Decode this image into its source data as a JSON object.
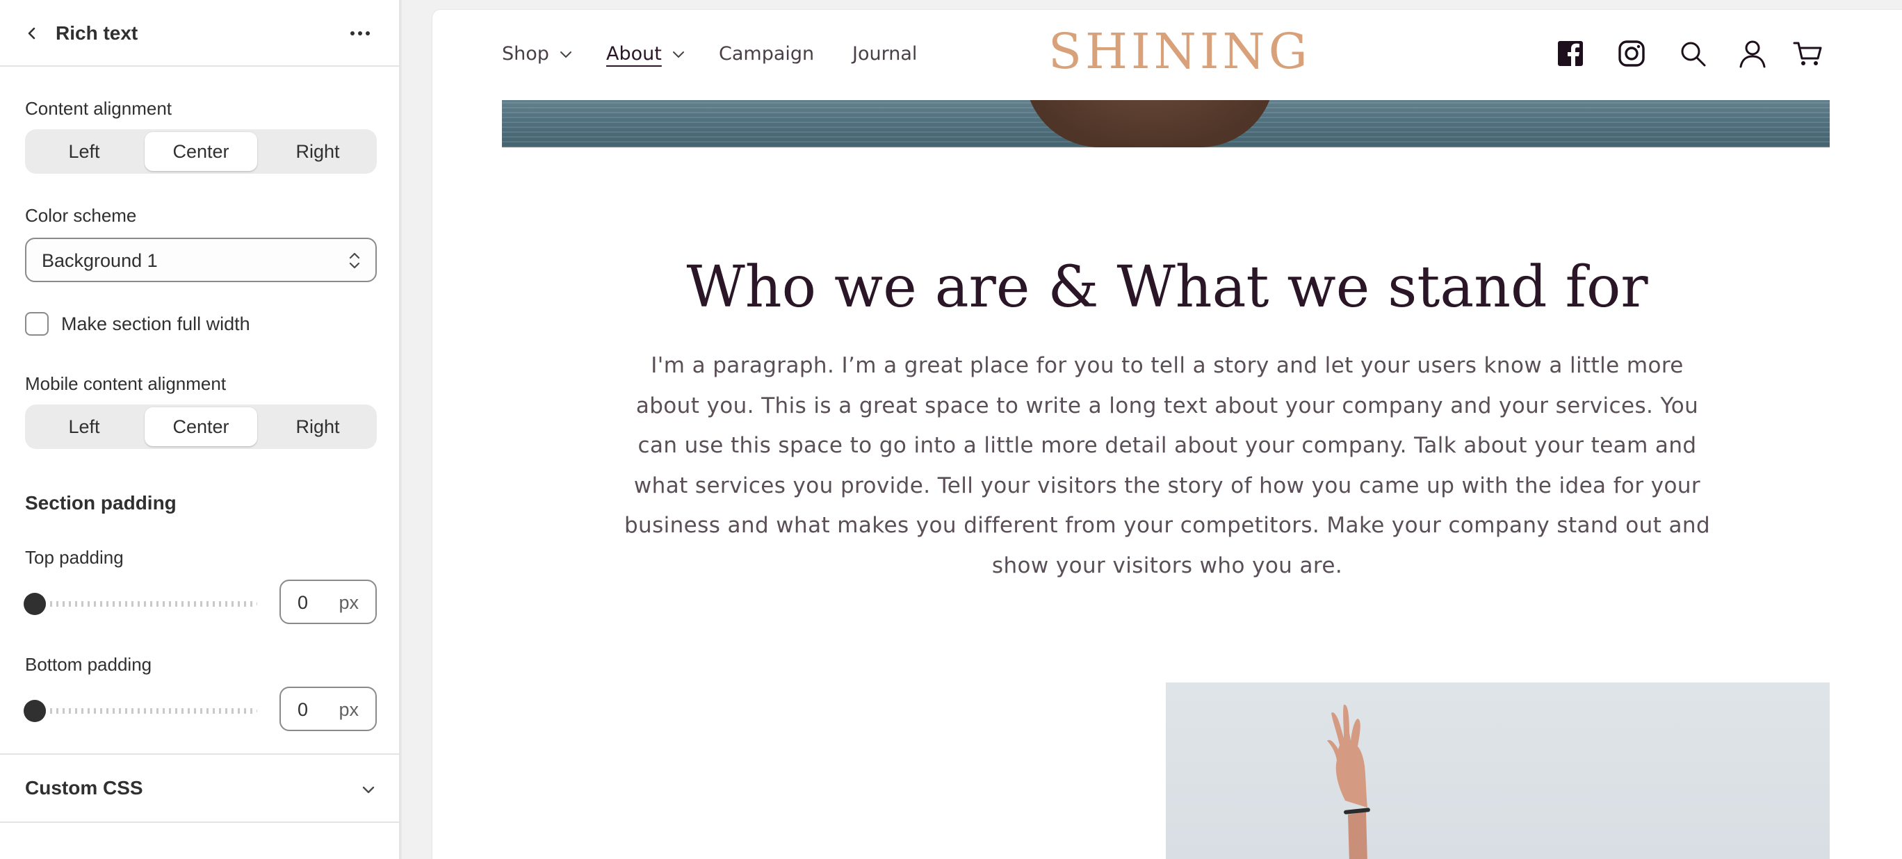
{
  "panel": {
    "title": "Rich text",
    "content_alignment": {
      "label": "Content alignment",
      "options": [
        "Left",
        "Center",
        "Right"
      ],
      "selected": "Center"
    },
    "color_scheme": {
      "label": "Color scheme",
      "value": "Background 1"
    },
    "full_width": {
      "label": "Make section full width",
      "checked": false
    },
    "mobile_alignment": {
      "label": "Mobile content alignment",
      "options": [
        "Left",
        "Center",
        "Right"
      ],
      "selected": "Center"
    },
    "section_padding": {
      "heading": "Section padding",
      "top": {
        "label": "Top padding",
        "value": "0",
        "unit": "px"
      },
      "bottom": {
        "label": "Bottom padding",
        "value": "0",
        "unit": "px"
      }
    },
    "custom_css": {
      "label": "Custom CSS"
    }
  },
  "store": {
    "logo": "SHINING",
    "nav": [
      {
        "label": "Shop",
        "has_dropdown": true,
        "active": false
      },
      {
        "label": "About",
        "has_dropdown": true,
        "active": true
      },
      {
        "label": "Campaign",
        "has_dropdown": false,
        "active": false
      },
      {
        "label": "Journal",
        "has_dropdown": false,
        "active": false
      }
    ],
    "icons": [
      "facebook-icon",
      "instagram-icon",
      "search-icon",
      "account-icon",
      "cart-icon"
    ],
    "rich_text": {
      "heading": "Who we are & What we stand for",
      "body": "I'm a paragraph. I’m a great place for you to tell a story and let your users know a little more about you. This is a great space to write a long text about your company and your services. You can use this space to go into a little more detail about your company. Talk about your team and what services you provide. Tell your visitors the story of how you came up with the idea for your business and what makes you different from your competitors. Make your company stand out and show your visitors who you are."
    }
  },
  "colors": {
    "heading": "#2a1626",
    "body_text": "#5a4f57",
    "logo": "#d9a17a",
    "panel_text": "#303030"
  }
}
